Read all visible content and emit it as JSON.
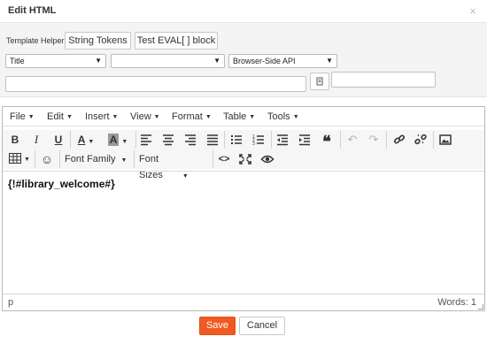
{
  "dialog": {
    "title": "Edit HTML",
    "close_glyph": "×"
  },
  "helper": {
    "label": "Template Helper",
    "string_tokens_label": "String Tokens",
    "test_eval_label": "Test EVAL[ ] block",
    "select_1": "Title",
    "select_2": "",
    "select_3": "Browser-Side API",
    "text_input_1": "",
    "text_input_2": ""
  },
  "menubar": {
    "items": [
      {
        "label": "File"
      },
      {
        "label": "Edit"
      },
      {
        "label": "Insert"
      },
      {
        "label": "View"
      },
      {
        "label": "Format"
      },
      {
        "label": "Table"
      },
      {
        "label": "Tools"
      }
    ]
  },
  "toolbar": {
    "font_family_label": "Font Family",
    "font_sizes_label": "Font Sizes"
  },
  "editor": {
    "content": "{!#library_welcome#}",
    "status_path": "p",
    "word_count": "Words: 1"
  },
  "footer": {
    "save_label": "Save",
    "cancel_label": "Cancel"
  },
  "colors": {
    "accent": "#f05a22",
    "toolbar_bg": "#f6f6f6",
    "panel_bg": "#f4f4f4"
  },
  "icons": [
    "close-icon",
    "document-icon",
    "bold-icon",
    "italic-icon",
    "underline-icon",
    "text-color-icon",
    "background-color-icon",
    "align-left-icon",
    "align-center-icon",
    "align-right-icon",
    "justify-icon",
    "bullet-list-icon",
    "numbered-list-icon",
    "outdent-icon",
    "indent-icon",
    "blockquote-icon",
    "undo-icon",
    "redo-icon",
    "link-icon",
    "unlink-icon",
    "image-icon",
    "table-icon",
    "emoticon-icon",
    "source-code-icon",
    "fullscreen-icon",
    "preview-icon"
  ]
}
